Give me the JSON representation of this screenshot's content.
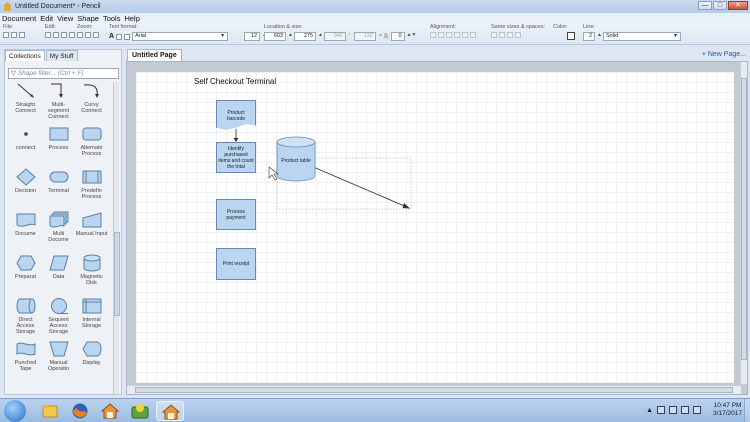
{
  "window": {
    "title": "Untitled Document* - Pencil",
    "controls": [
      "—",
      "□",
      "✕"
    ]
  },
  "menu": [
    "Document",
    "Edit",
    "View",
    "Shape",
    "Tools",
    "Help"
  ],
  "toolbar": {
    "file_label": "File:",
    "edit_label": "Edit:",
    "zoom_label": "Zoom:",
    "text_format_label": "Text format:",
    "font_value": "Arial",
    "font_size": "12",
    "location_label": "Location & size:",
    "x_value": "603",
    "y_value": "275",
    "w_value": "342",
    "h_value": "132",
    "angle_value": "0",
    "alignment_label": "Alignment:",
    "same_sizes_label": "Same sizes & spaces:",
    "color_label": "Color:",
    "line_label": "Line:",
    "line_width": "2",
    "line_style": "Solid",
    "text_bold_icon": "A"
  },
  "left_panel": {
    "tabs": [
      "Collections",
      "My Stuff"
    ],
    "filter_placeholder": "Shape filter... (Ctrl + F)",
    "shapes": [
      {
        "label": "Straight Connect",
        "icon": "straight-connector-icon"
      },
      {
        "label": "Multi-segment Connect",
        "icon": "multi-segment-connector-icon"
      },
      {
        "label": "Curvy Connect",
        "icon": "curvy-connector-icon"
      },
      {
        "label": "connect",
        "icon": "connect-point-icon"
      },
      {
        "label": "Process",
        "icon": "process-icon"
      },
      {
        "label": "Alternate Process",
        "icon": "alternate-process-icon"
      },
      {
        "label": "Decision",
        "icon": "decision-icon"
      },
      {
        "label": "Terminal",
        "icon": "terminal-icon"
      },
      {
        "label": "Predefin Process",
        "icon": "predefined-process-icon"
      },
      {
        "label": "Docume",
        "icon": "document-icon"
      },
      {
        "label": "Multi Docume",
        "icon": "multi-document-icon"
      },
      {
        "label": "Manual Input",
        "icon": "manual-input-icon"
      },
      {
        "label": "Preparat",
        "icon": "preparation-icon"
      },
      {
        "label": "Data",
        "icon": "data-icon"
      },
      {
        "label": "Magnetic Disk",
        "icon": "magnetic-disk-icon"
      },
      {
        "label": "Direct Access Storage",
        "icon": "direct-access-storage-icon"
      },
      {
        "label": "Sequent Access Storage",
        "icon": "sequential-access-storage-icon"
      },
      {
        "label": "Internal Storage",
        "icon": "internal-storage-icon"
      },
      {
        "label": "Punched Tape",
        "icon": "punched-tape-icon"
      },
      {
        "label": "Manual Operatio",
        "icon": "manual-operation-icon"
      },
      {
        "label": "Display",
        "icon": "display-icon"
      }
    ]
  },
  "page_tabs": {
    "active": "Untitled Page",
    "new_page": "+ New Page..."
  },
  "diagram": {
    "title": "Self Checkout Terminal",
    "nodes": {
      "product_barcode": "Product barcode",
      "identify": "Identify purchased items and count the total",
      "product_table": "Product table",
      "process_payment": "Process payment",
      "print_receipt": "Print receipt"
    },
    "colors": {
      "node_fill": "#b9d5ef",
      "node_border": "#6789ac"
    }
  },
  "taskbar": {
    "time": "10:47 PM",
    "date": "3/17/2017",
    "apps": [
      "explorer-icon",
      "firefox-icon",
      "pencil-icon",
      "game-icon",
      "pencil-active-icon"
    ]
  }
}
